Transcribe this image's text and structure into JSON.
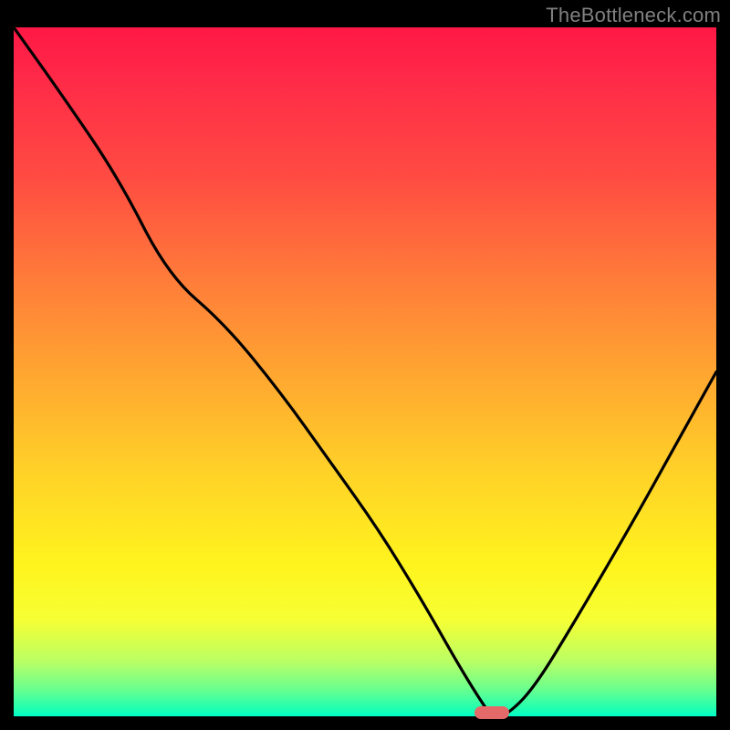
{
  "attribution": "TheBottleneck.com",
  "colors": {
    "marker": "#e46a6a",
    "curve": "#000000"
  },
  "chart_data": {
    "type": "line",
    "title": "",
    "xlabel": "",
    "ylabel": "",
    "xlim": [
      0,
      100
    ],
    "ylim": [
      0,
      100
    ],
    "grid": false,
    "legend": false,
    "series": [
      {
        "name": "bottleneck-curve",
        "x": [
          0,
          7,
          15,
          22,
          30,
          38,
          45,
          52,
          58,
          63,
          66,
          68,
          70,
          74,
          80,
          88,
          94,
          100
        ],
        "values": [
          100,
          90,
          78,
          64,
          57,
          47,
          37,
          27,
          17,
          8,
          3,
          0,
          0,
          4,
          14,
          28,
          39,
          50
        ]
      }
    ],
    "annotations": [
      {
        "name": "optimal-marker",
        "x": 68,
        "y": 0.5
      }
    ],
    "background_gradient_stops": [
      {
        "pos": 0,
        "color": "#ff1846"
      },
      {
        "pos": 50,
        "color": "#ffa531"
      },
      {
        "pos": 78,
        "color": "#fff41e"
      },
      {
        "pos": 100,
        "color": "#00ffc9"
      }
    ]
  }
}
